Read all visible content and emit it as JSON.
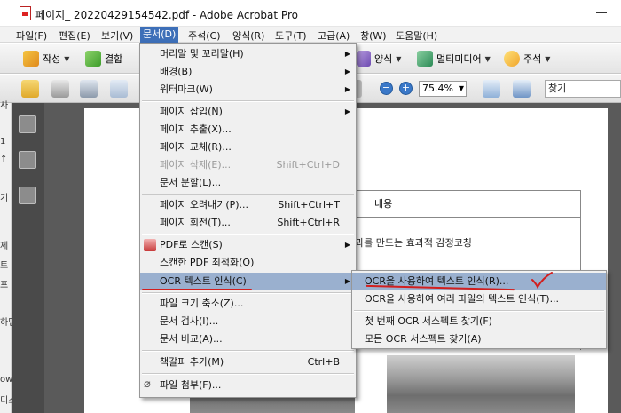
{
  "window": {
    "title": "페이지_ 20220429154542.pdf - Adobe Acrobat Pro",
    "icon": "pdf-file-icon"
  },
  "menubar": {
    "items": [
      "파일(F)",
      "편집(E)",
      "보기(V)",
      "문서(D)",
      "주석(C)",
      "양식(R)",
      "도구(T)",
      "고급(A)",
      "창(W)",
      "도움말(H)"
    ],
    "active": "문서(D)"
  },
  "toolbar1": {
    "create_label": "작성",
    "combine_label": "결합",
    "forms_label": "양식",
    "multimedia_label": "멀티미디어",
    "comment_label": "주석"
  },
  "toolbar2": {
    "zoom": "75.4%",
    "find_placeholder": "찾기"
  },
  "left_strip": {
    "fragments": [
      "사",
      "1",
      "↑",
      "기",
      "제",
      "트",
      "프",
      "하던",
      "ows",
      "디스"
    ]
  },
  "document": {
    "header": "내용",
    "line1": "과를 만드는 효과적 감정코칭"
  },
  "doc_menu": {
    "items": [
      {
        "label": "머리말 및 꼬리말(H)",
        "shortcut": "",
        "submenu": true,
        "disabled": false
      },
      {
        "label": "배경(B)",
        "shortcut": "",
        "submenu": true,
        "disabled": false
      },
      {
        "label": "워터마크(W)",
        "shortcut": "",
        "submenu": true,
        "disabled": false
      },
      {
        "label": "페이지 삽입(N)",
        "shortcut": "",
        "submenu": true,
        "disabled": false
      },
      {
        "label": "페이지 추출(X)...",
        "shortcut": "",
        "submenu": false,
        "disabled": false
      },
      {
        "label": "페이지 교체(R)...",
        "shortcut": "",
        "submenu": false,
        "disabled": false
      },
      {
        "label": "페이지 삭제(E)...",
        "shortcut": "Shift+Ctrl+D",
        "submenu": false,
        "disabled": true
      },
      {
        "label": "문서 분할(L)...",
        "shortcut": "",
        "submenu": false,
        "disabled": false
      },
      {
        "label": "페이지 오려내기(P)...",
        "shortcut": "Shift+Ctrl+T",
        "submenu": false,
        "disabled": false
      },
      {
        "label": "페이지 회전(T)...",
        "shortcut": "Shift+Ctrl+R",
        "submenu": false,
        "disabled": false
      },
      {
        "label": "PDF로 스캔(S)",
        "shortcut": "",
        "submenu": true,
        "disabled": false
      },
      {
        "label": "스캔한 PDF 최적화(O)",
        "shortcut": "",
        "submenu": false,
        "disabled": false
      },
      {
        "label": "OCR 텍스트 인식(C)",
        "shortcut": "",
        "submenu": true,
        "disabled": false
      },
      {
        "label": "파일 크기 축소(Z)...",
        "shortcut": "",
        "submenu": false,
        "disabled": false
      },
      {
        "label": "문서 검사(I)...",
        "shortcut": "",
        "submenu": false,
        "disabled": false
      },
      {
        "label": "문서 비교(A)...",
        "shortcut": "",
        "submenu": false,
        "disabled": false
      },
      {
        "label": "책갈피 추가(M)",
        "shortcut": "Ctrl+B",
        "submenu": false,
        "disabled": false
      },
      {
        "label": "파일 첨부(F)...",
        "shortcut": "",
        "submenu": false,
        "disabled": false
      }
    ]
  },
  "ocr_submenu": {
    "items": [
      {
        "label": "OCR을 사용하여 텍스트 인식(R)..."
      },
      {
        "label": "OCR을 사용하여 여러 파일의 텍스트 인식(T)..."
      },
      {
        "label": "첫 번째 OCR 서스펙트 찾기(F)"
      },
      {
        "label": "모든 OCR 서스펙트 찾기(A)"
      }
    ]
  },
  "colors": {
    "menu_active": "#3d6fb8",
    "menu_highlight": "#9ab0cf",
    "annotation_red": "#d21f1f"
  }
}
